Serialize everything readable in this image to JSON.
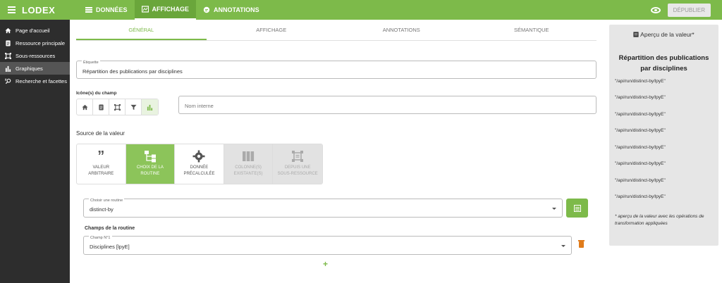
{
  "app": {
    "logo": "LODEX"
  },
  "top_nav": [
    {
      "label": "DONNÉES",
      "active": false
    },
    {
      "label": "AFFICHAGE",
      "active": true
    },
    {
      "label": "ANNOTATIONS",
      "active": false
    }
  ],
  "publish_label": "DÉPUBLIER",
  "sidebar": {
    "items": [
      {
        "label": "Page d'accueil",
        "icon": "home-icon",
        "active": false
      },
      {
        "label": "Ressource principale",
        "icon": "document-icon",
        "active": false
      },
      {
        "label": "Sous-ressources",
        "icon": "subresource-icon",
        "active": false
      },
      {
        "label": "Graphiques",
        "icon": "chart-icon",
        "active": true
      },
      {
        "label": "Recherche et facettes",
        "icon": "search-facets-icon",
        "active": false
      }
    ]
  },
  "subtabs": [
    {
      "label": "GÉNÉRAL",
      "active": true
    },
    {
      "label": "AFFICHAGE",
      "active": false
    },
    {
      "label": "ANNOTATIONS",
      "active": false
    },
    {
      "label": "SÉMANTIQUE",
      "active": false
    }
  ],
  "etiquette": {
    "label": "Étiquette",
    "value": "Répartition des publications par disciplines"
  },
  "icons_label": "Icône(s) du champ",
  "internal_name": {
    "placeholder": "Nom interne"
  },
  "source": {
    "title": "Source de la valeur",
    "options": [
      {
        "label1": "VALEUR",
        "label2": "ARBITRAIRE",
        "state": "normal"
      },
      {
        "label1": "CHOIX DE LA",
        "label2": "ROUTINE",
        "state": "active"
      },
      {
        "label1": "DONNÉE",
        "label2": "PRÉCALCULÉE",
        "state": "normal"
      },
      {
        "label1": "COLONNE(S)",
        "label2": "EXISTANTE(S)",
        "state": "disabled"
      },
      {
        "label1": "DEPUIS UNE",
        "label2": "SOUS-RESSOURCE",
        "state": "disabled"
      }
    ]
  },
  "routine": {
    "label": "Choisir une routine",
    "value": "distinct-by"
  },
  "routine_fields": {
    "title": "Champs de la routine",
    "field_label": "Champ N°1",
    "field_value": "Disciplines [lpyE]"
  },
  "preview": {
    "header": "Aperçu de la valeur*",
    "title": "Répartition des publications par disciplines",
    "lines": [
      "\"/api/run/distinct-by/lpyE\"",
      "\"/api/run/distinct-by/lpyE\"",
      "\"/api/run/distinct-by/lpyE\"",
      "\"/api/run/distinct-by/lpyE\"",
      "\"/api/run/distinct-by/lpyE\"",
      "\"/api/run/distinct-by/lpyE\"",
      "\"/api/run/distinct-by/lpyE\"",
      "\"/api/run/distinct-by/lpyE\""
    ],
    "note": "* aperçu de la valeur avec les opérations de transformation appliquées"
  },
  "colors": {
    "brand": "#7dba4a",
    "sidebar": "#2d2d2d",
    "danger": "#e07b1a"
  }
}
